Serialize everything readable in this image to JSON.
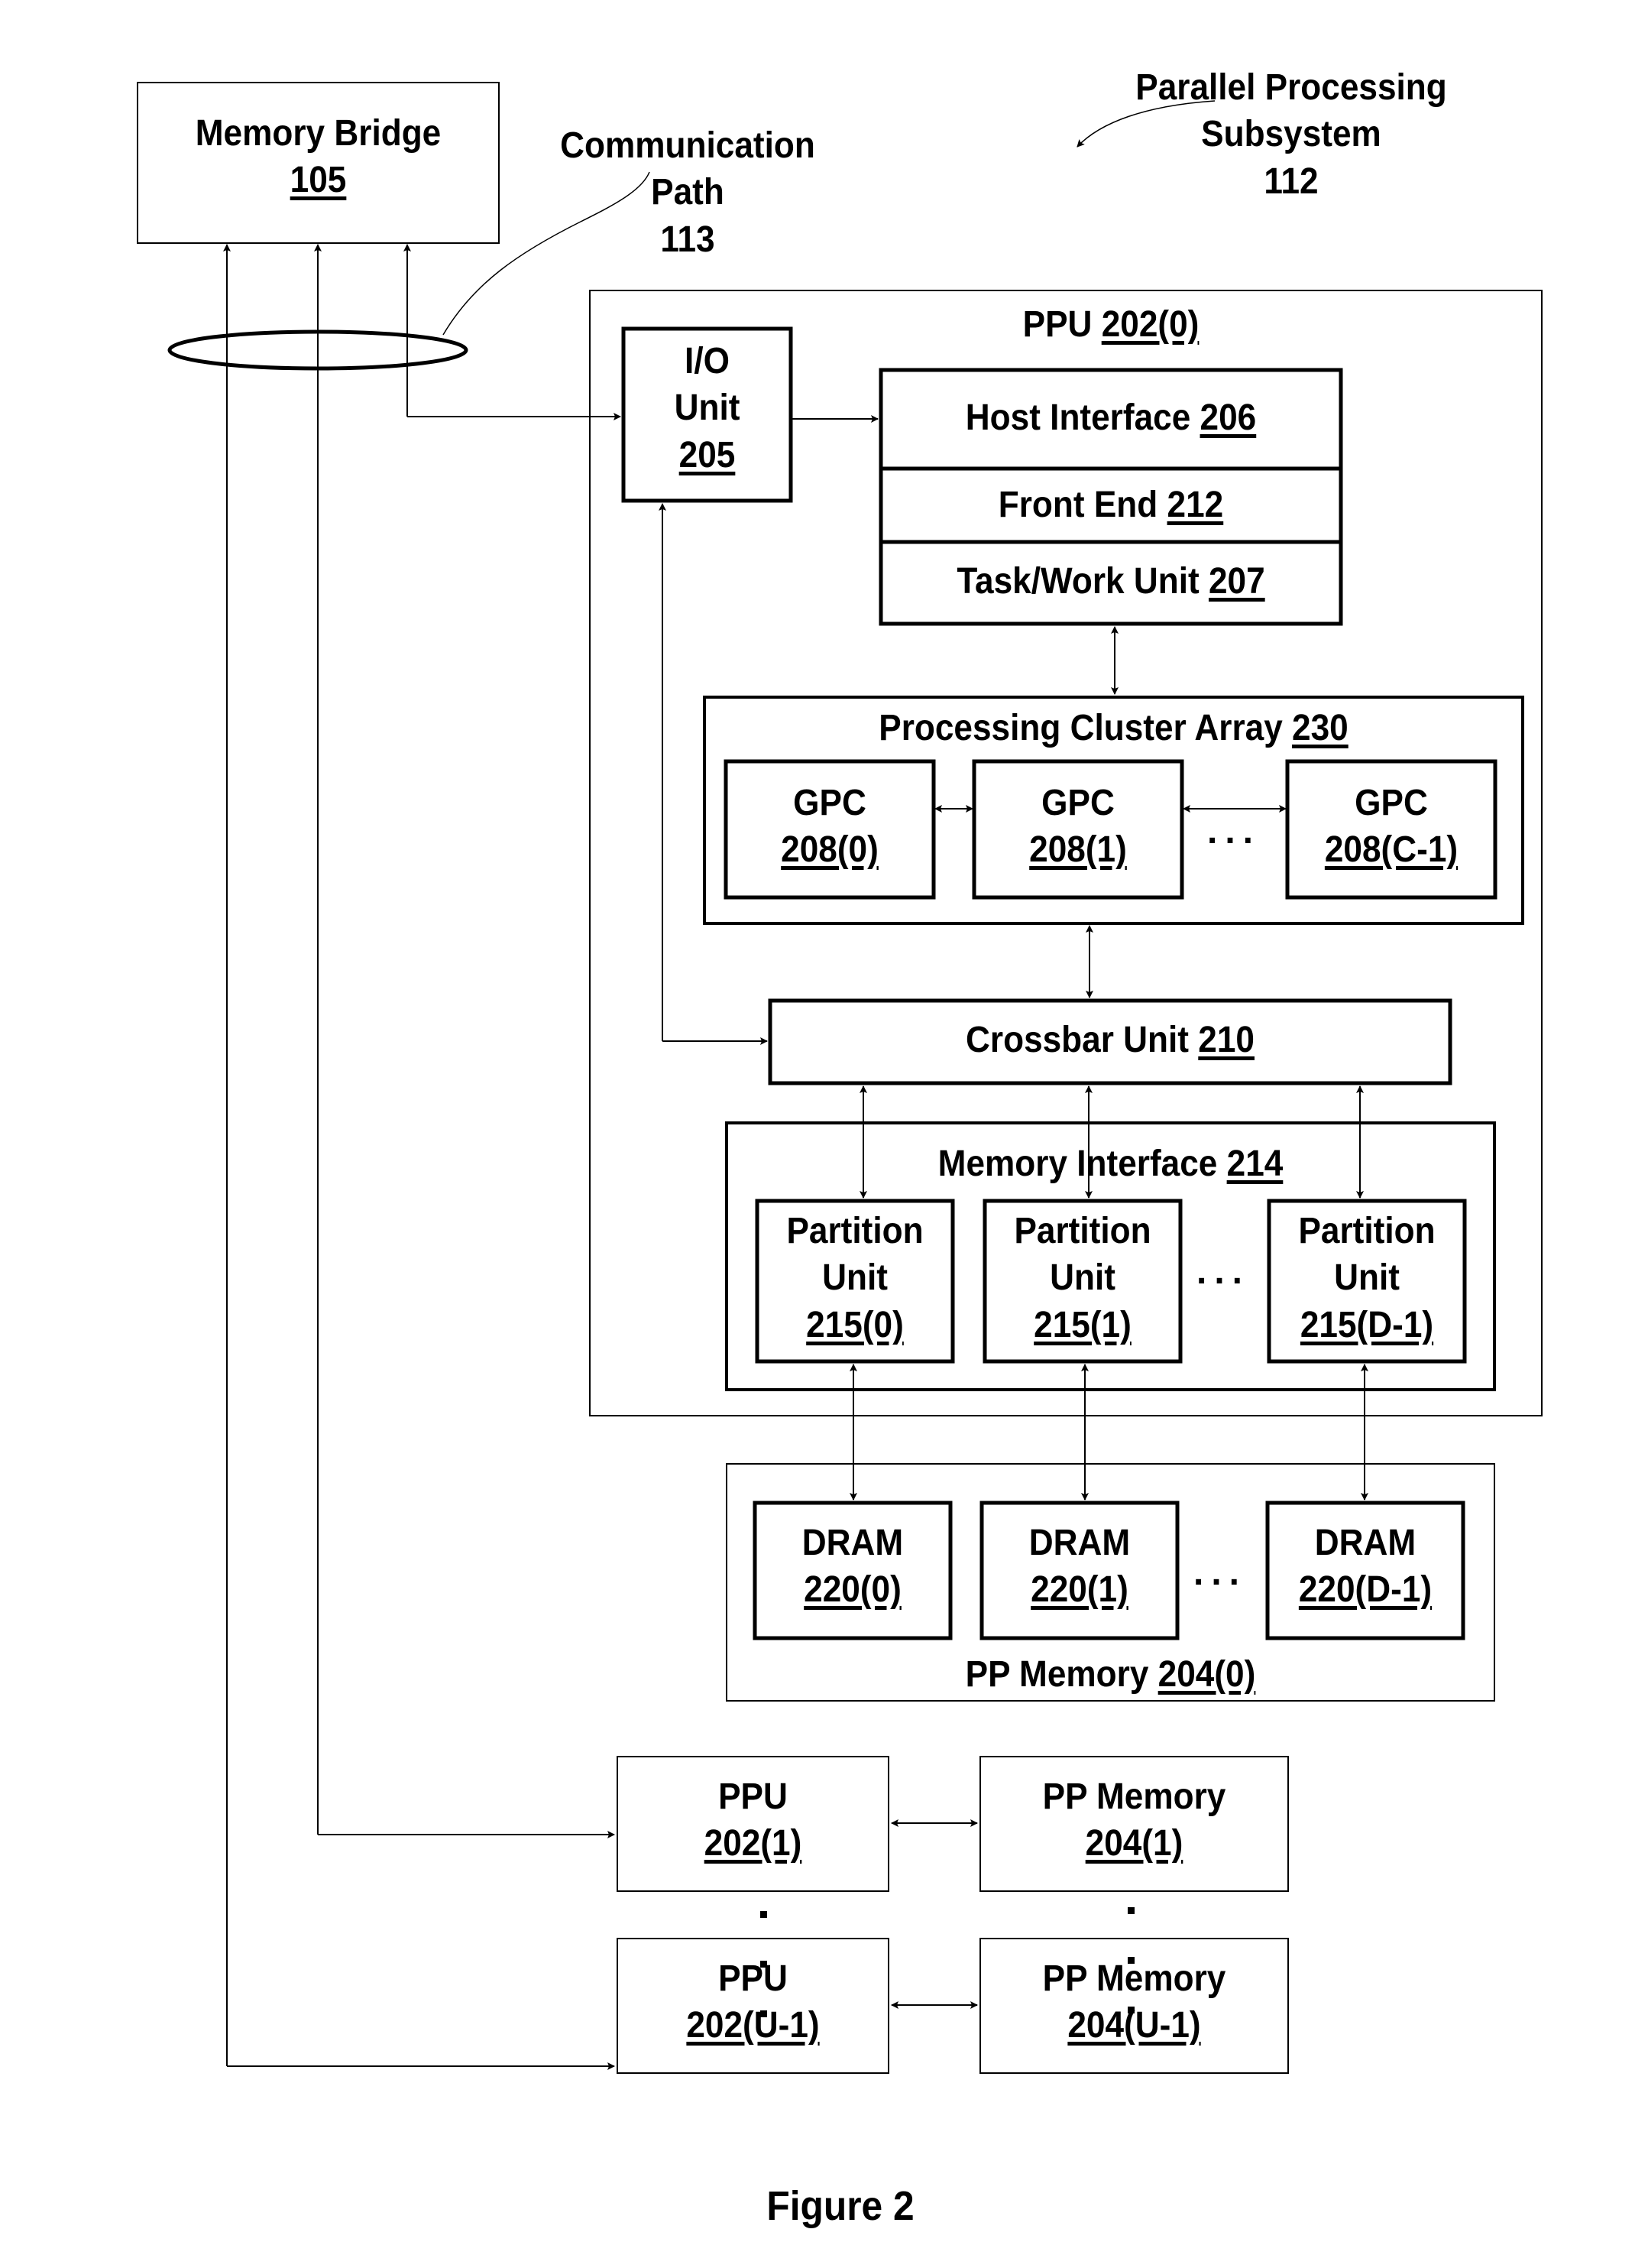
{
  "figure": {
    "caption": "Figure 2",
    "colors": {
      "line": "#000000",
      "background": "#ffffff"
    }
  },
  "labels": {
    "subsystem": {
      "line1": "Parallel Processing",
      "line2": "Subsystem",
      "ref": "112"
    },
    "comm_path": {
      "line1": "Communication",
      "line2": "Path",
      "ref": "113"
    }
  },
  "memory_bridge": {
    "name": "Memory Bridge",
    "ref": "105"
  },
  "ppu0": {
    "name": "PPU",
    "ref": "202(0)",
    "io_unit": {
      "line1": "I/O",
      "line2": "Unit",
      "ref": "205"
    },
    "host_interface": {
      "name": "Host Interface",
      "ref": "206"
    },
    "front_end": {
      "name": "Front End",
      "ref": "212"
    },
    "task_work_unit": {
      "name": "Task/Work Unit",
      "ref": "207"
    },
    "pca": {
      "name": "Processing Cluster Array",
      "ref": "230",
      "gpcs": [
        {
          "name": "GPC",
          "ref": "208(0)"
        },
        {
          "name": "GPC",
          "ref": "208(1)"
        },
        {
          "name": "GPC",
          "ref": "208(C-1)"
        }
      ],
      "ellipsis": "..."
    },
    "crossbar": {
      "name": "Crossbar Unit",
      "ref": "210"
    },
    "memory_interface": {
      "name": "Memory Interface",
      "ref": "214",
      "partitions": [
        {
          "line1": "Partition",
          "line2": "Unit",
          "ref": "215(0)"
        },
        {
          "line1": "Partition",
          "line2": "Unit",
          "ref": "215(1)"
        },
        {
          "line1": "Partition",
          "line2": "Unit",
          "ref": "215(D-1)"
        }
      ],
      "ellipsis": "..."
    }
  },
  "pp_memory0": {
    "name": "PP Memory",
    "ref": "204(0)",
    "drams": [
      {
        "name": "DRAM",
        "ref": "220(0)"
      },
      {
        "name": "DRAM",
        "ref": "220(1)"
      },
      {
        "name": "DRAM",
        "ref": "220(D-1)"
      }
    ],
    "ellipsis": "..."
  },
  "other_ppus": [
    {
      "ppu_name": "PPU",
      "ppu_ref": "202(1)",
      "mem_name": "PP Memory",
      "mem_ref": "204(1)"
    },
    {
      "ppu_name": "PPU",
      "ppu_ref": "202(U-1)",
      "mem_name": "PP Memory",
      "mem_ref": "204(U-1)"
    }
  ]
}
